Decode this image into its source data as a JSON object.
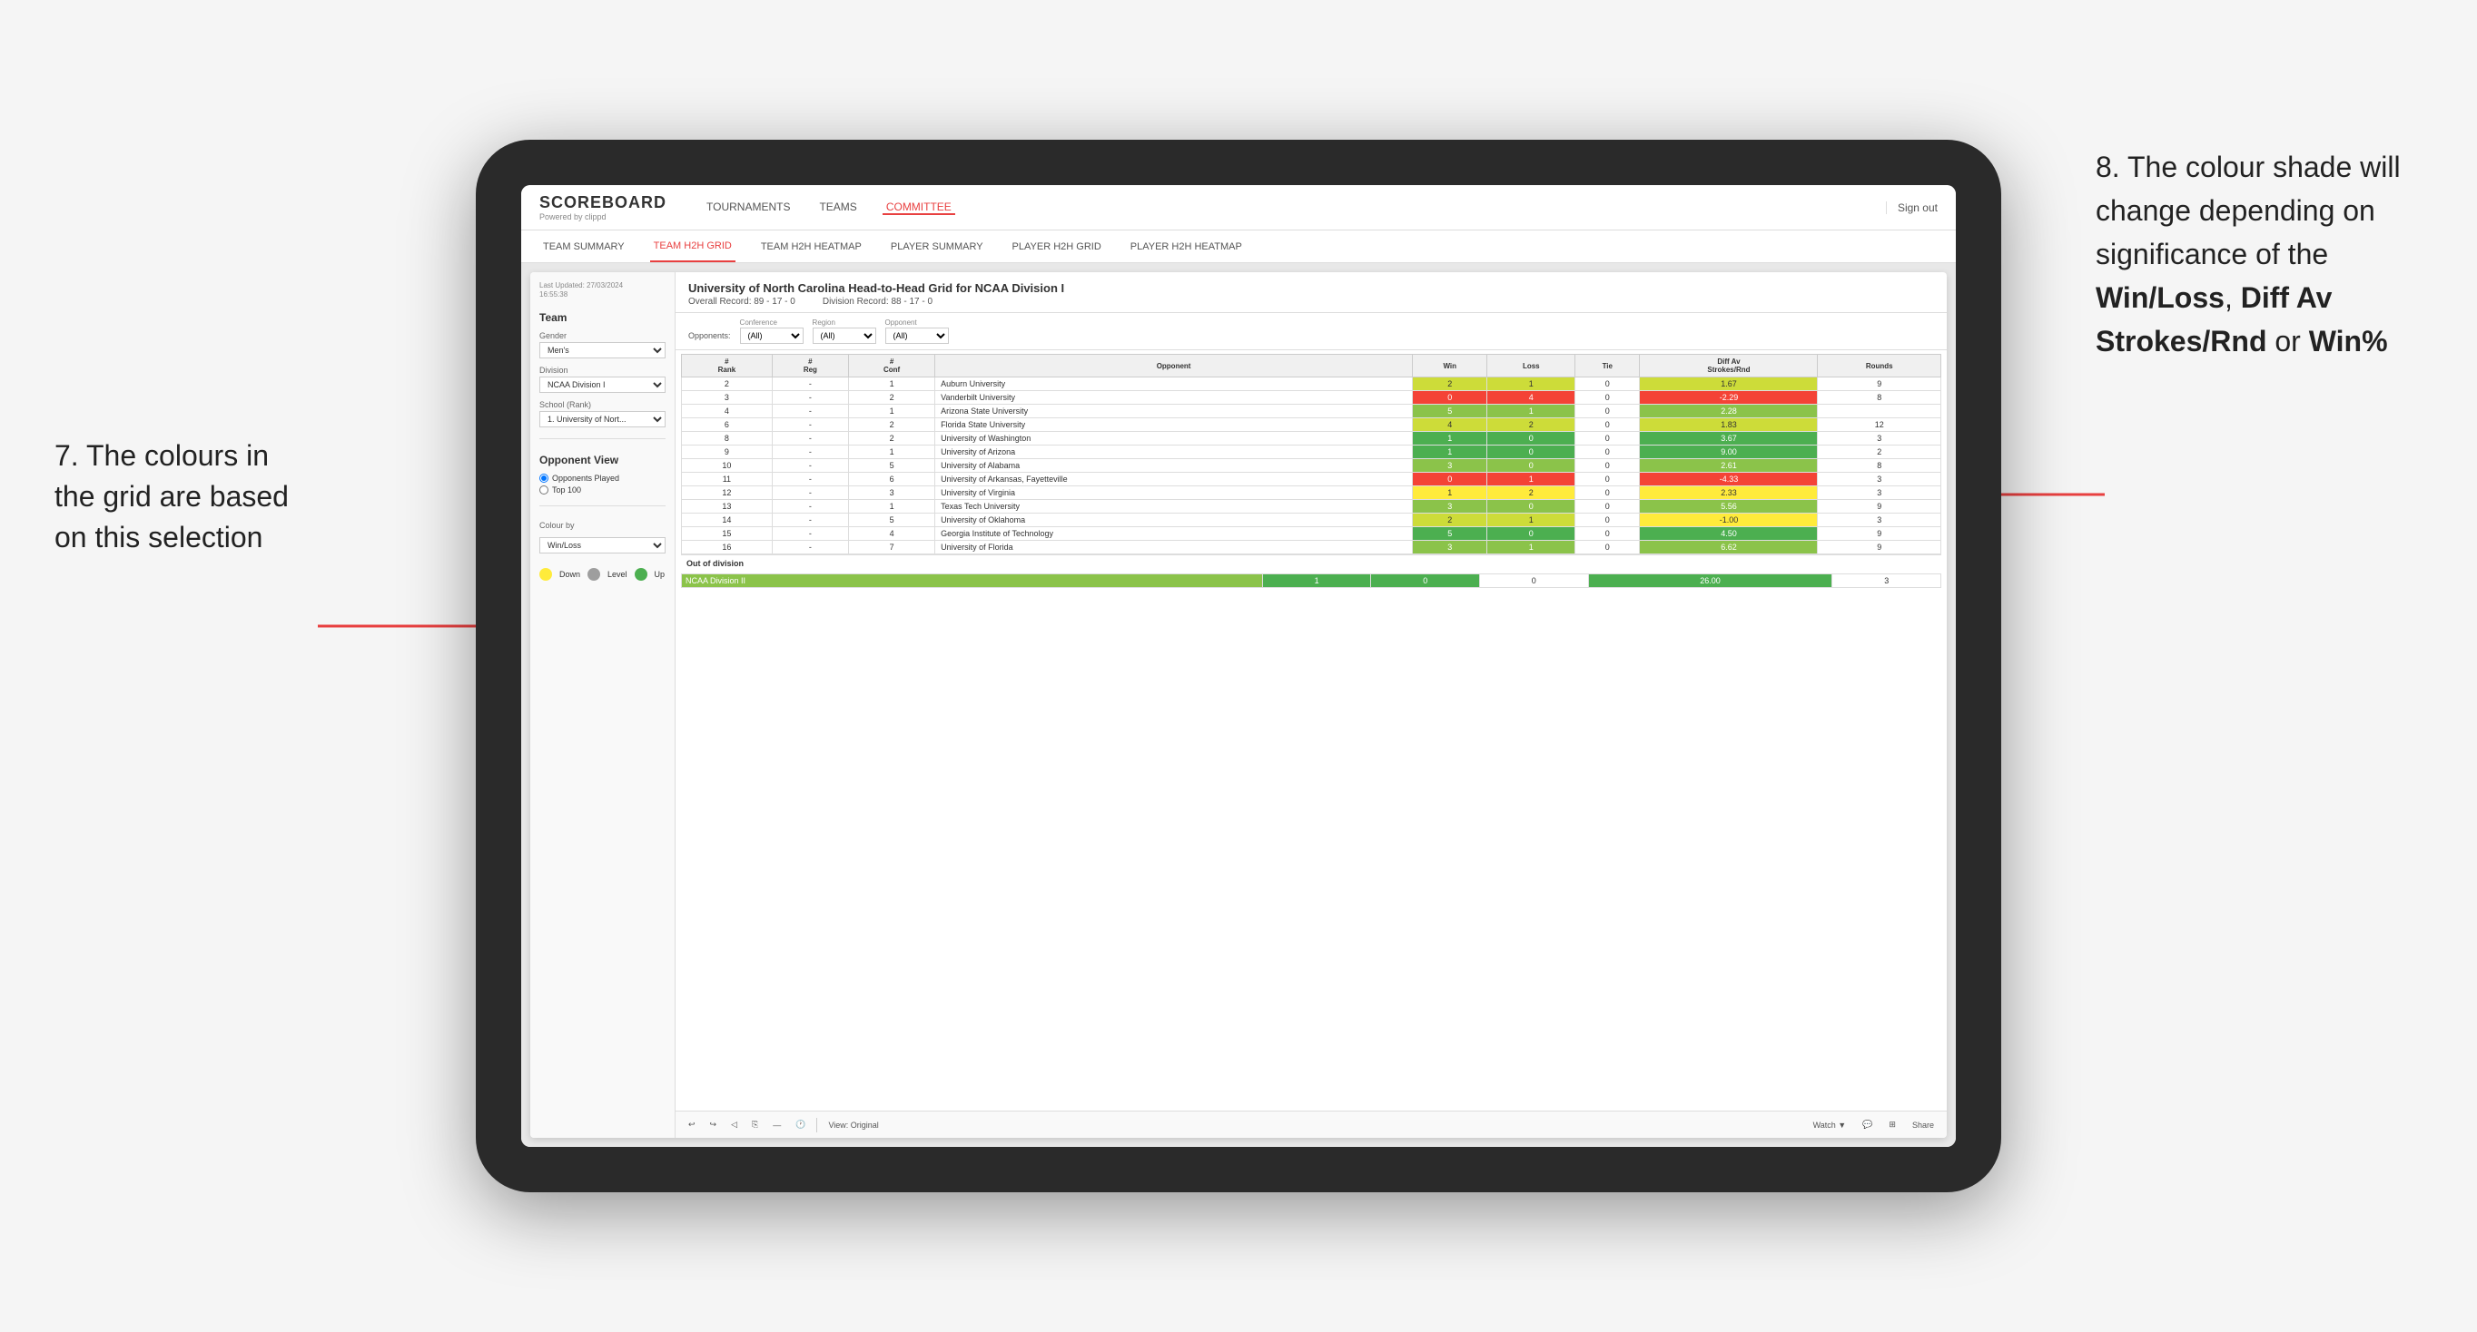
{
  "page": {
    "bg_color": "#f5f5f5"
  },
  "annotation_left": {
    "text": "7. The colours in the grid are based on this selection"
  },
  "annotation_right": {
    "prefix": "8. The colour shade will change depending on significance of the ",
    "bold1": "Win/Loss",
    "sep1": ", ",
    "bold2": "Diff Av Strokes/Rnd",
    "sep2": " or ",
    "bold3": "Win%"
  },
  "nav": {
    "logo": "SCOREBOARD",
    "logo_sub": "Powered by clippd",
    "items": [
      "TOURNAMENTS",
      "TEAMS",
      "COMMITTEE"
    ],
    "active": "COMMITTEE",
    "sign_out": "Sign out"
  },
  "sub_nav": {
    "items": [
      "TEAM SUMMARY",
      "TEAM H2H GRID",
      "TEAM H2H HEATMAP",
      "PLAYER SUMMARY",
      "PLAYER H2H GRID",
      "PLAYER H2H HEATMAP"
    ],
    "active": "TEAM H2H GRID"
  },
  "sidebar": {
    "timestamp_label": "Last Updated: 27/03/2024",
    "timestamp_time": "16:55:38",
    "team_label": "Team",
    "gender_label": "Gender",
    "gender_value": "Men's",
    "division_label": "Division",
    "division_value": "NCAA Division I",
    "school_label": "School (Rank)",
    "school_value": "1. University of Nort...",
    "opponent_view_label": "Opponent View",
    "radio1": "Opponents Played",
    "radio2": "Top 100",
    "colour_by_label": "Colour by",
    "colour_by_value": "Win/Loss",
    "legend": [
      {
        "color": "#ffeb3b",
        "label": "Down"
      },
      {
        "color": "#9e9e9e",
        "label": "Level"
      },
      {
        "color": "#4caf50",
        "label": "Up"
      }
    ]
  },
  "grid": {
    "title": "University of North Carolina Head-to-Head Grid for NCAA Division I",
    "overall_record_label": "Overall Record:",
    "overall_record": "89 - 17 - 0",
    "division_record_label": "Division Record:",
    "division_record": "88 - 17 - 0",
    "filters": {
      "opponents_label": "Opponents:",
      "conference_label": "Conference",
      "conference_value": "(All)",
      "region_label": "Region",
      "region_value": "(All)",
      "opponent_label": "Opponent",
      "opponent_value": "(All)"
    },
    "columns": [
      "#\nRank",
      "#\nReg",
      "#\nConf",
      "Opponent",
      "Win",
      "Loss",
      "Tie",
      "Diff Av\nStrokes/Rnd",
      "Rounds"
    ],
    "rows": [
      {
        "rank": "2",
        "reg": "-",
        "conf": "1",
        "opponent": "Auburn University",
        "win": "2",
        "loss": "1",
        "tie": "0",
        "diff": "1.67",
        "rounds": "9",
        "win_color": "cell-green-light",
        "diff_color": "cell-green-light"
      },
      {
        "rank": "3",
        "reg": "-",
        "conf": "2",
        "opponent": "Vanderbilt University",
        "win": "0",
        "loss": "4",
        "tie": "0",
        "diff": "-2.29",
        "rounds": "8",
        "win_color": "cell-red",
        "diff_color": "cell-red"
      },
      {
        "rank": "4",
        "reg": "-",
        "conf": "1",
        "opponent": "Arizona State University",
        "win": "5",
        "loss": "1",
        "tie": "0",
        "diff": "2.28",
        "rounds": "",
        "win_color": "cell-green-medium",
        "diff_color": "cell-green-medium"
      },
      {
        "rank": "6",
        "reg": "-",
        "conf": "2",
        "opponent": "Florida State University",
        "win": "4",
        "loss": "2",
        "tie": "0",
        "diff": "1.83",
        "rounds": "12",
        "win_color": "cell-green-light",
        "diff_color": "cell-green-light"
      },
      {
        "rank": "8",
        "reg": "-",
        "conf": "2",
        "opponent": "University of Washington",
        "win": "1",
        "loss": "0",
        "tie": "0",
        "diff": "3.67",
        "rounds": "3",
        "win_color": "cell-green-dark",
        "diff_color": "cell-green-dark"
      },
      {
        "rank": "9",
        "reg": "-",
        "conf": "1",
        "opponent": "University of Arizona",
        "win": "1",
        "loss": "0",
        "tie": "0",
        "diff": "9.00",
        "rounds": "2",
        "win_color": "cell-green-dark",
        "diff_color": "cell-green-dark"
      },
      {
        "rank": "10",
        "reg": "-",
        "conf": "5",
        "opponent": "University of Alabama",
        "win": "3",
        "loss": "0",
        "tie": "0",
        "diff": "2.61",
        "rounds": "8",
        "win_color": "cell-green-medium",
        "diff_color": "cell-green-medium"
      },
      {
        "rank": "11",
        "reg": "-",
        "conf": "6",
        "opponent": "University of Arkansas, Fayetteville",
        "win": "0",
        "loss": "1",
        "tie": "0",
        "diff": "-4.33",
        "rounds": "3",
        "win_color": "cell-red",
        "diff_color": "cell-red"
      },
      {
        "rank": "12",
        "reg": "-",
        "conf": "3",
        "opponent": "University of Virginia",
        "win": "1",
        "loss": "2",
        "tie": "0",
        "diff": "2.33",
        "rounds": "3",
        "win_color": "cell-yellow",
        "diff_color": "cell-yellow"
      },
      {
        "rank": "13",
        "reg": "-",
        "conf": "1",
        "opponent": "Texas Tech University",
        "win": "3",
        "loss": "0",
        "tie": "0",
        "diff": "5.56",
        "rounds": "9",
        "win_color": "cell-green-medium",
        "diff_color": "cell-green-medium"
      },
      {
        "rank": "14",
        "reg": "-",
        "conf": "5",
        "opponent": "University of Oklahoma",
        "win": "2",
        "loss": "1",
        "tie": "0",
        "diff": "-1.00",
        "rounds": "3",
        "win_color": "cell-green-light",
        "diff_color": "cell-yellow"
      },
      {
        "rank": "15",
        "reg": "-",
        "conf": "4",
        "opponent": "Georgia Institute of Technology",
        "win": "5",
        "loss": "0",
        "tie": "0",
        "diff": "4.50",
        "rounds": "9",
        "win_color": "cell-green-dark",
        "diff_color": "cell-green-dark"
      },
      {
        "rank": "16",
        "reg": "-",
        "conf": "7",
        "opponent": "University of Florida",
        "win": "3",
        "loss": "1",
        "tie": "0",
        "diff": "6.62",
        "rounds": "9",
        "win_color": "cell-green-medium",
        "diff_color": "cell-green-medium"
      }
    ],
    "out_of_division_label": "Out of division",
    "out_of_division_rows": [
      {
        "division": "NCAA Division II",
        "win": "1",
        "loss": "0",
        "tie": "0",
        "diff": "26.00",
        "rounds": "3",
        "win_color": "cell-green-dark",
        "diff_color": "cell-green-dark"
      }
    ]
  },
  "toolbar": {
    "view_label": "View: Original",
    "watch_label": "Watch ▼",
    "share_label": "Share"
  }
}
